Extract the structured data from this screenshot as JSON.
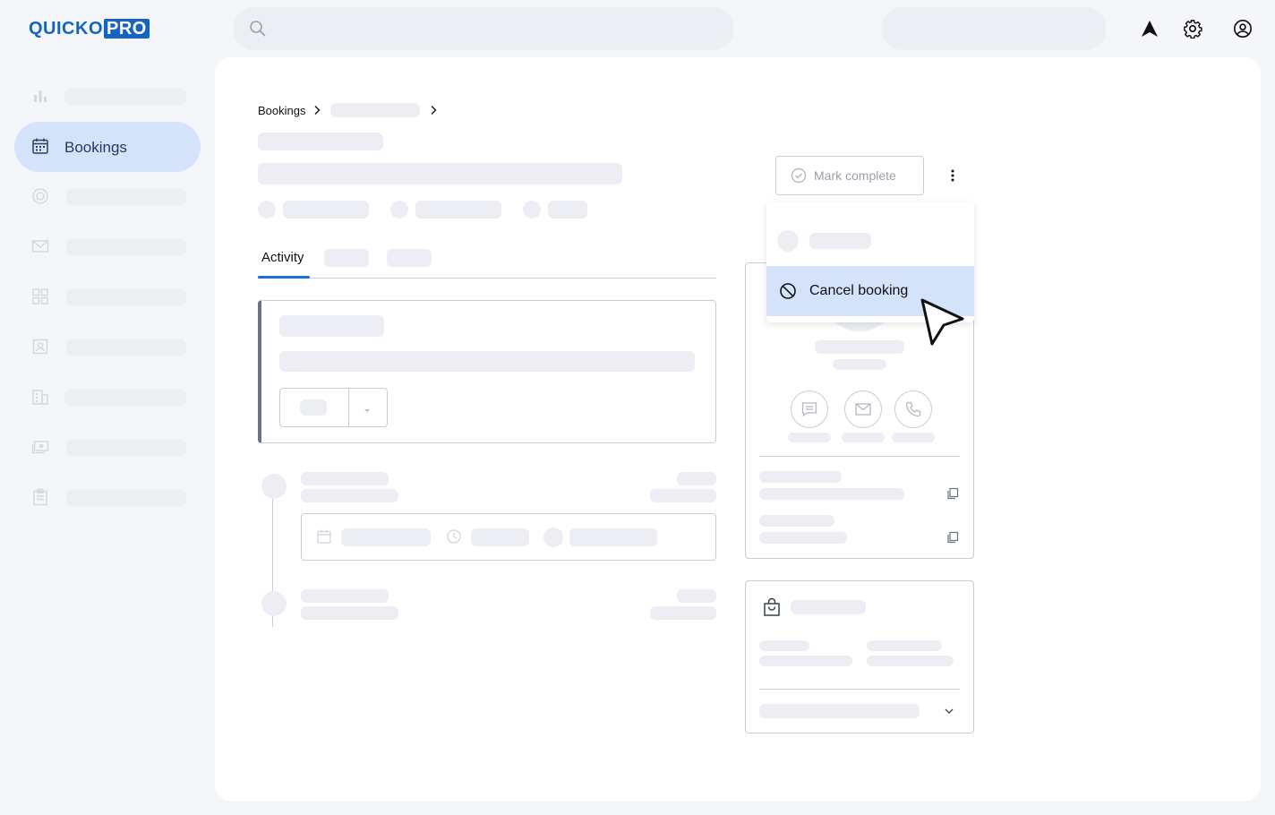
{
  "brand": {
    "logo_part1": "QUICKO",
    "logo_part2": "PRO"
  },
  "header": {
    "search_icon": "search-icon",
    "icons": [
      "navigation-arrow-icon",
      "gear-icon",
      "account-circle-icon"
    ]
  },
  "sidebar": {
    "items": [
      {
        "icon": "bar-chart-icon",
        "label": ""
      },
      {
        "icon": "calendar-icon",
        "label": "Bookings",
        "active": true
      },
      {
        "icon": "target-icon",
        "label": ""
      },
      {
        "icon": "mail-icon",
        "label": ""
      },
      {
        "icon": "grid-icon",
        "label": ""
      },
      {
        "icon": "contact-card-icon",
        "label": ""
      },
      {
        "icon": "building-icon",
        "label": ""
      },
      {
        "icon": "cash-icon",
        "label": ""
      },
      {
        "icon": "clipboard-icon",
        "label": ""
      }
    ]
  },
  "breadcrumb": {
    "root": "Bookings",
    "separator_icon": "chevron-right-icon"
  },
  "tabs": {
    "active_label": "Activity"
  },
  "actions": {
    "mark_complete_label": "Mark complete",
    "mark_complete_icon": "check-circle-icon",
    "more_icon": "more-vertical-icon"
  },
  "dropdown_menu": {
    "cancel_label": "Cancel booking",
    "cancel_icon": "block-icon"
  },
  "colors": {
    "accent": "#1565c0",
    "active_bg": "#d5e3fa",
    "skeleton": "#eceef3",
    "tab_underline": "#1e6fd9"
  }
}
